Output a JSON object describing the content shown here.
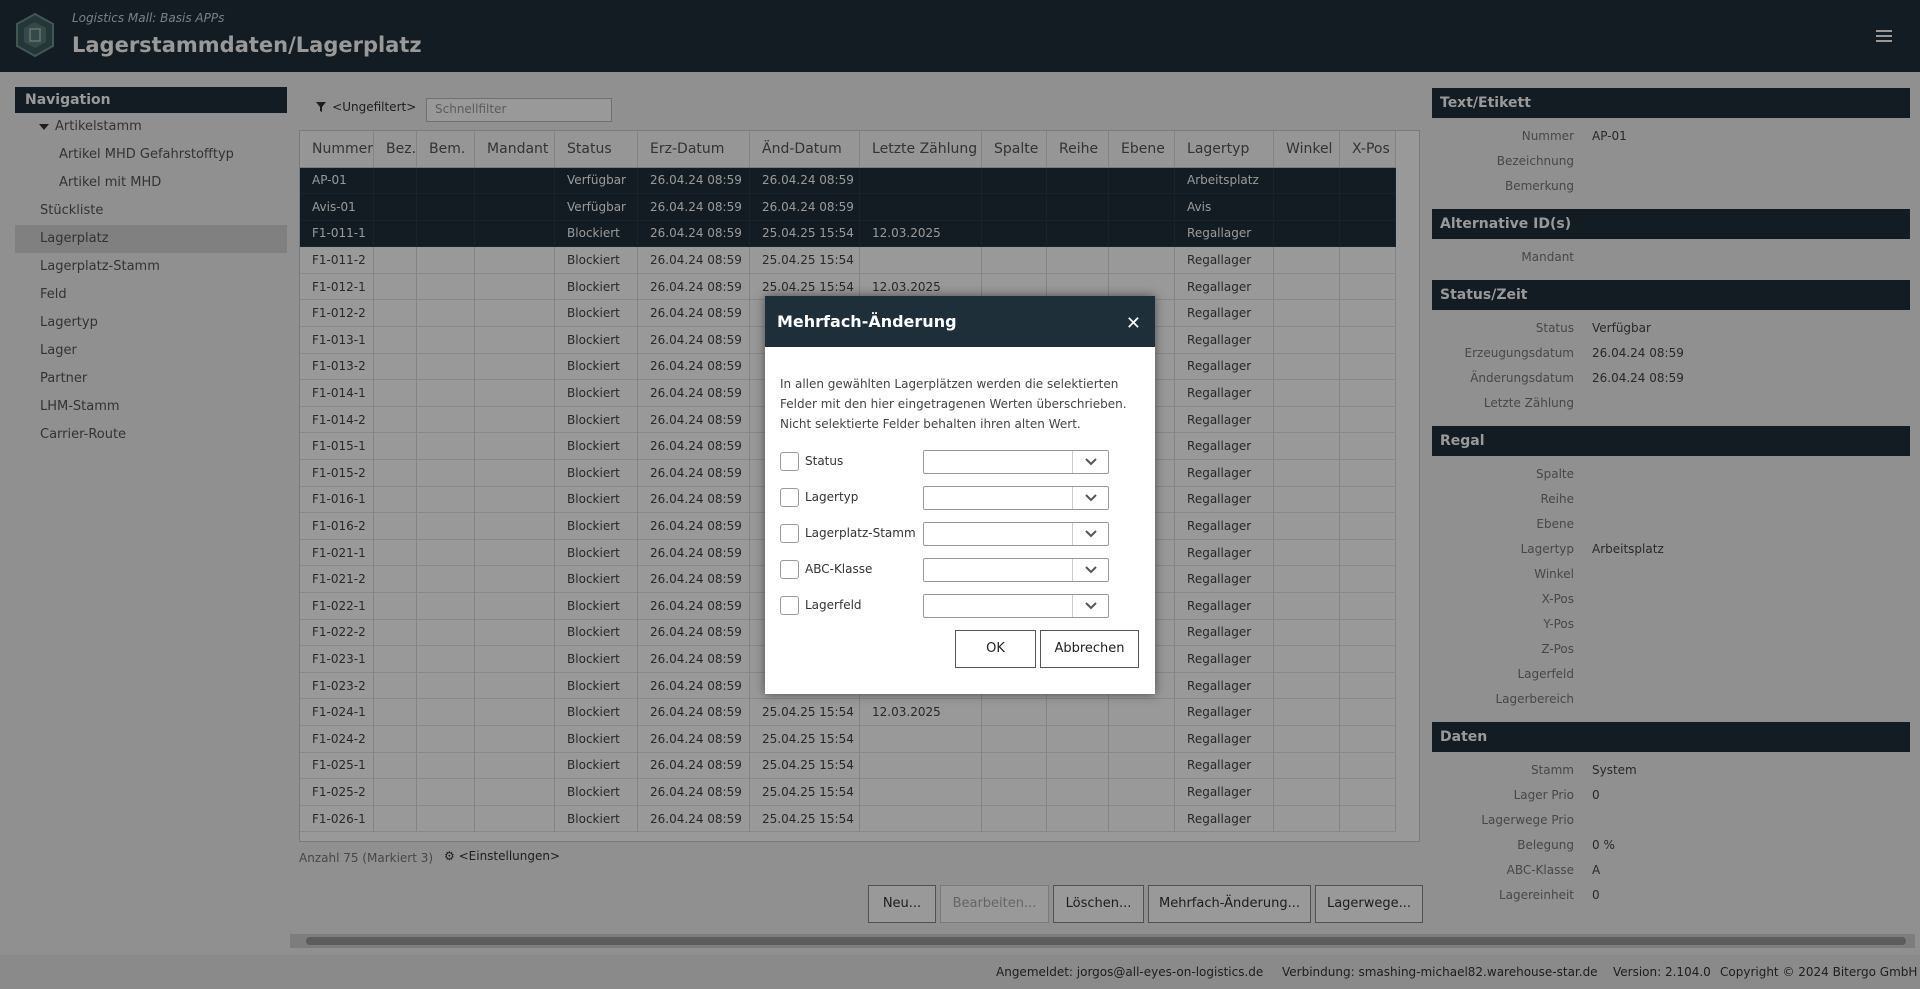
{
  "header": {
    "subtitle": "Logistics Mall: Basis APPs",
    "title": "Lagerstammdaten/Lagerplatz"
  },
  "nav": {
    "heading": "Navigation",
    "items": [
      {
        "label": "Artikelstamm"
      },
      {
        "label": "Artikel MHD Gefahrstofftyp"
      },
      {
        "label": "Artikel mit MHD"
      },
      {
        "label": "Stückliste"
      },
      {
        "label": "Lagerplatz"
      },
      {
        "label": "Lagerplatz-Stamm"
      },
      {
        "label": "Feld"
      },
      {
        "label": "Lagertyp"
      },
      {
        "label": "Lager"
      },
      {
        "label": "Partner"
      },
      {
        "label": "LHM-Stamm"
      },
      {
        "label": "Carrier-Route"
      }
    ]
  },
  "filter": {
    "label": "<Ungefiltert>",
    "placeholder": "Schnellfilter"
  },
  "table": {
    "columns": [
      "Nummer",
      "Bez.",
      "Bem.",
      "Mandant",
      "Status",
      "Erz-Datum",
      "Änd-Datum",
      "Letzte Zählung",
      "Spalte",
      "Reihe",
      "Ebene",
      "Lagertyp",
      "Winkel",
      "X-Pos"
    ],
    "rows": [
      [
        "AP-01",
        "",
        "",
        "",
        "Verfügbar",
        "26.04.24 08:59",
        "26.04.24 08:59",
        "",
        "",
        "",
        "",
        "Arbeitsplatz",
        "",
        ""
      ],
      [
        "Avis-01",
        "",
        "",
        "",
        "Verfügbar",
        "26.04.24 08:59",
        "26.04.24 08:59",
        "",
        "",
        "",
        "",
        "Avis",
        "",
        ""
      ],
      [
        "F1-011-1",
        "",
        "",
        "",
        "Blockiert",
        "26.04.24 08:59",
        "25.04.25 15:54",
        "12.03.2025",
        "",
        "",
        "",
        "Regallager",
        "",
        ""
      ],
      [
        "F1-011-2",
        "",
        "",
        "",
        "Blockiert",
        "26.04.24 08:59",
        "25.04.25 15:54",
        "",
        "",
        "",
        "",
        "Regallager",
        "",
        ""
      ],
      [
        "F1-012-1",
        "",
        "",
        "",
        "Blockiert",
        "26.04.24 08:59",
        "25.04.25 15:54",
        "12.03.2025",
        "",
        "",
        "",
        "Regallager",
        "",
        ""
      ],
      [
        "F1-012-2",
        "",
        "",
        "",
        "Blockiert",
        "26.04.24 08:59",
        "",
        "",
        "",
        "",
        "",
        "Regallager",
        "",
        ""
      ],
      [
        "F1-013-1",
        "",
        "",
        "",
        "Blockiert",
        "26.04.24 08:59",
        "",
        "",
        "",
        "",
        "",
        "Regallager",
        "",
        ""
      ],
      [
        "F1-013-2",
        "",
        "",
        "",
        "Blockiert",
        "26.04.24 08:59",
        "",
        "",
        "",
        "",
        "",
        "Regallager",
        "",
        ""
      ],
      [
        "F1-014-1",
        "",
        "",
        "",
        "Blockiert",
        "26.04.24 08:59",
        "",
        "",
        "",
        "",
        "",
        "Regallager",
        "",
        ""
      ],
      [
        "F1-014-2",
        "",
        "",
        "",
        "Blockiert",
        "26.04.24 08:59",
        "",
        "",
        "",
        "",
        "",
        "Regallager",
        "",
        ""
      ],
      [
        "F1-015-1",
        "",
        "",
        "",
        "Blockiert",
        "26.04.24 08:59",
        "",
        "",
        "",
        "",
        "",
        "Regallager",
        "",
        ""
      ],
      [
        "F1-015-2",
        "",
        "",
        "",
        "Blockiert",
        "26.04.24 08:59",
        "",
        "",
        "",
        "",
        "",
        "Regallager",
        "",
        ""
      ],
      [
        "F1-016-1",
        "",
        "",
        "",
        "Blockiert",
        "26.04.24 08:59",
        "",
        "",
        "",
        "",
        "",
        "Regallager",
        "",
        ""
      ],
      [
        "F1-016-2",
        "",
        "",
        "",
        "Blockiert",
        "26.04.24 08:59",
        "",
        "",
        "",
        "",
        "",
        "Regallager",
        "",
        ""
      ],
      [
        "F1-021-1",
        "",
        "",
        "",
        "Blockiert",
        "26.04.24 08:59",
        "",
        "",
        "",
        "",
        "",
        "Regallager",
        "",
        ""
      ],
      [
        "F1-021-2",
        "",
        "",
        "",
        "Blockiert",
        "26.04.24 08:59",
        "",
        "",
        "",
        "",
        "",
        "Regallager",
        "",
        ""
      ],
      [
        "F1-022-1",
        "",
        "",
        "",
        "Blockiert",
        "26.04.24 08:59",
        "",
        "",
        "",
        "",
        "",
        "Regallager",
        "",
        ""
      ],
      [
        "F1-022-2",
        "",
        "",
        "",
        "Blockiert",
        "26.04.24 08:59",
        "",
        "",
        "",
        "",
        "",
        "Regallager",
        "",
        ""
      ],
      [
        "F1-023-1",
        "",
        "",
        "",
        "Blockiert",
        "26.04.24 08:59",
        "",
        "",
        "",
        "",
        "",
        "Regallager",
        "",
        ""
      ],
      [
        "F1-023-2",
        "",
        "",
        "",
        "Blockiert",
        "26.04.24 08:59",
        "",
        "",
        "",
        "",
        "",
        "Regallager",
        "",
        ""
      ],
      [
        "F1-024-1",
        "",
        "",
        "",
        "Blockiert",
        "26.04.24 08:59",
        "25.04.25 15:54",
        "12.03.2025",
        "",
        "",
        "",
        "Regallager",
        "",
        ""
      ],
      [
        "F1-024-2",
        "",
        "",
        "",
        "Blockiert",
        "26.04.24 08:59",
        "25.04.25 15:54",
        "",
        "",
        "",
        "",
        "Regallager",
        "",
        ""
      ],
      [
        "F1-025-1",
        "",
        "",
        "",
        "Blockiert",
        "26.04.24 08:59",
        "25.04.25 15:54",
        "",
        "",
        "",
        "",
        "Regallager",
        "",
        ""
      ],
      [
        "F1-025-2",
        "",
        "",
        "",
        "Blockiert",
        "26.04.24 08:59",
        "25.04.25 15:54",
        "",
        "",
        "",
        "",
        "Regallager",
        "",
        ""
      ],
      [
        "F1-026-1",
        "",
        "",
        "",
        "Blockiert",
        "26.04.24 08:59",
        "25.04.25 15:54",
        "",
        "",
        "",
        "",
        "Regallager",
        "",
        ""
      ]
    ]
  },
  "status_bar": {
    "count": "Anzahl 75 (Markiert 3)",
    "settings": "<Einstellungen>"
  },
  "buttons": {
    "new": "Neu...",
    "edit": "Bearbeiten...",
    "delete": "Löschen...",
    "multi": "Mehrfach-Änderung...",
    "routes": "Lagerwege..."
  },
  "detail": {
    "sections": [
      {
        "title": "Text/Etikett",
        "fields": [
          [
            "Nummer",
            "AP-01"
          ],
          [
            "Bezeichnung",
            ""
          ],
          [
            "Bemerkung",
            ""
          ]
        ]
      },
      {
        "title": "Alternative ID(s)",
        "fields": [
          [
            "Mandant",
            ""
          ]
        ]
      },
      {
        "title": "Status/Zeit",
        "fields": [
          [
            "Status",
            "Verfügbar"
          ],
          [
            "Erzeugungsdatum",
            "26.04.24 08:59"
          ],
          [
            "Änderungsdatum",
            "26.04.24 08:59"
          ],
          [
            "Letzte Zählung",
            ""
          ]
        ]
      },
      {
        "title": "Regal",
        "fields": [
          [
            "Spalte",
            ""
          ],
          [
            "Reihe",
            ""
          ],
          [
            "Ebene",
            ""
          ],
          [
            "Lagertyp",
            "Arbeitsplatz"
          ],
          [
            "Winkel",
            ""
          ],
          [
            "X-Pos",
            ""
          ],
          [
            "Y-Pos",
            ""
          ],
          [
            "Z-Pos",
            ""
          ],
          [
            "Lagerfeld",
            ""
          ],
          [
            "Lagerbereich",
            ""
          ]
        ]
      },
      {
        "title": "Daten",
        "fields": [
          [
            "Stamm",
            "System"
          ],
          [
            "Lager Prio",
            "0"
          ],
          [
            "Lagerwege Prio",
            ""
          ],
          [
            "Belegung",
            "0 %"
          ],
          [
            "ABC-Klasse",
            "A"
          ],
          [
            "Lagereinheit",
            "0"
          ]
        ]
      }
    ]
  },
  "footer": {
    "user": "Angemeldet: jorgos@all-eyes-on-logistics.de",
    "connection": "Verbindung: smashing-michael82.warehouse-star.de",
    "version": "Version: 2.104.0",
    "copyright": "Copyright © 2024 Bitergo GmbH"
  },
  "dialog": {
    "title": "Mehrfach-Änderung",
    "text_line1": "In allen gewählten Lagerplätzen werden die selektierten",
    "text_line2": "Felder mit den hier eingetragenen Werten überschrieben.",
    "text_line3": "Nicht selektierte Felder behalten ihren alten Wert.",
    "fields": [
      {
        "label": "Status",
        "value": ""
      },
      {
        "label": "Lagertyp",
        "value": ""
      },
      {
        "label": "Lagerplatz-Stamm",
        "value": ""
      },
      {
        "label": "ABC-Klasse",
        "value": ""
      },
      {
        "label": "Lagerfeld",
        "value": ""
      }
    ],
    "ok": "OK",
    "cancel": "Abbrechen"
  }
}
